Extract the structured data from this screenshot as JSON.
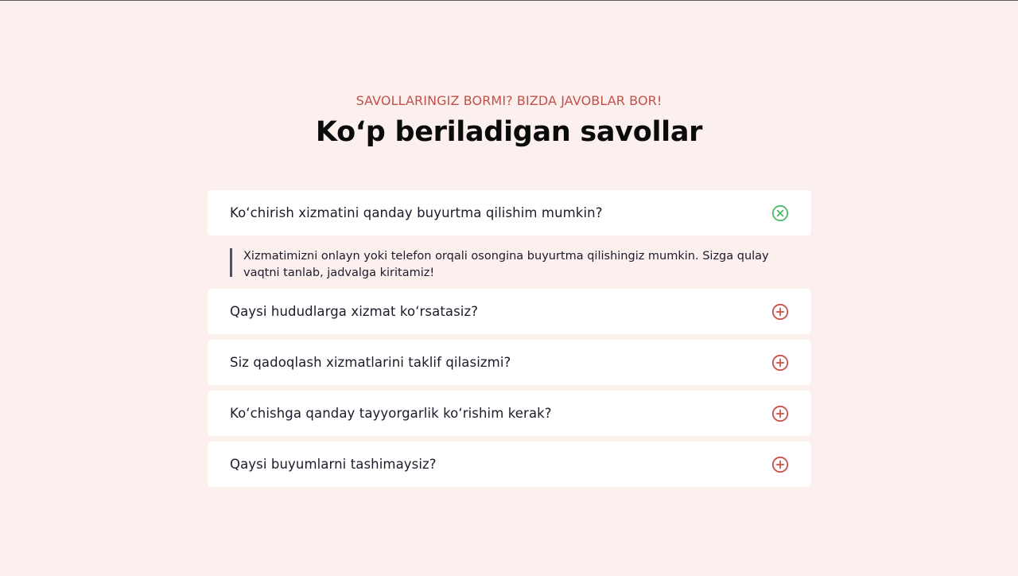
{
  "section": {
    "eyebrow": "SAVOLLARINGIZ BORMI? BIZDA JAVOBLAR BOR!",
    "title": "Ko‘p beriladigan savollar"
  },
  "faq": {
    "items": [
      {
        "question": "Ko‘chirish xizmatini qanday buyurtma qilishim mumkin?",
        "answer": "Xizmatimizni onlayn yoki telefon orqali osongina buyurtma qilishingiz mumkin. Sizga qulay vaqtni tanlab, jadvalga kiritamiz!",
        "expanded": true,
        "icon": "close-circle-icon"
      },
      {
        "question": "Qaysi hududlarga xizmat ko‘rsatasiz?",
        "expanded": false,
        "icon": "plus-circle-icon"
      },
      {
        "question": "Siz qadoqlash xizmatlarini taklif qilasizmi?",
        "expanded": false,
        "icon": "plus-circle-icon"
      },
      {
        "question": "Ko‘chishga qanday tayyorgarlik ko‘rishim kerak?",
        "expanded": false,
        "icon": "plus-circle-icon"
      },
      {
        "question": "Qaysi buyumlarni tashimaysiz?",
        "expanded": false,
        "icon": "plus-circle-icon"
      }
    ]
  },
  "colors": {
    "background": "#fcf0ef",
    "accent_red": "#c2504a",
    "icon_green": "#4cba6a",
    "icon_red": "#c9504b",
    "card": "#ffffff",
    "answer_rule": "#4d4f6b"
  }
}
